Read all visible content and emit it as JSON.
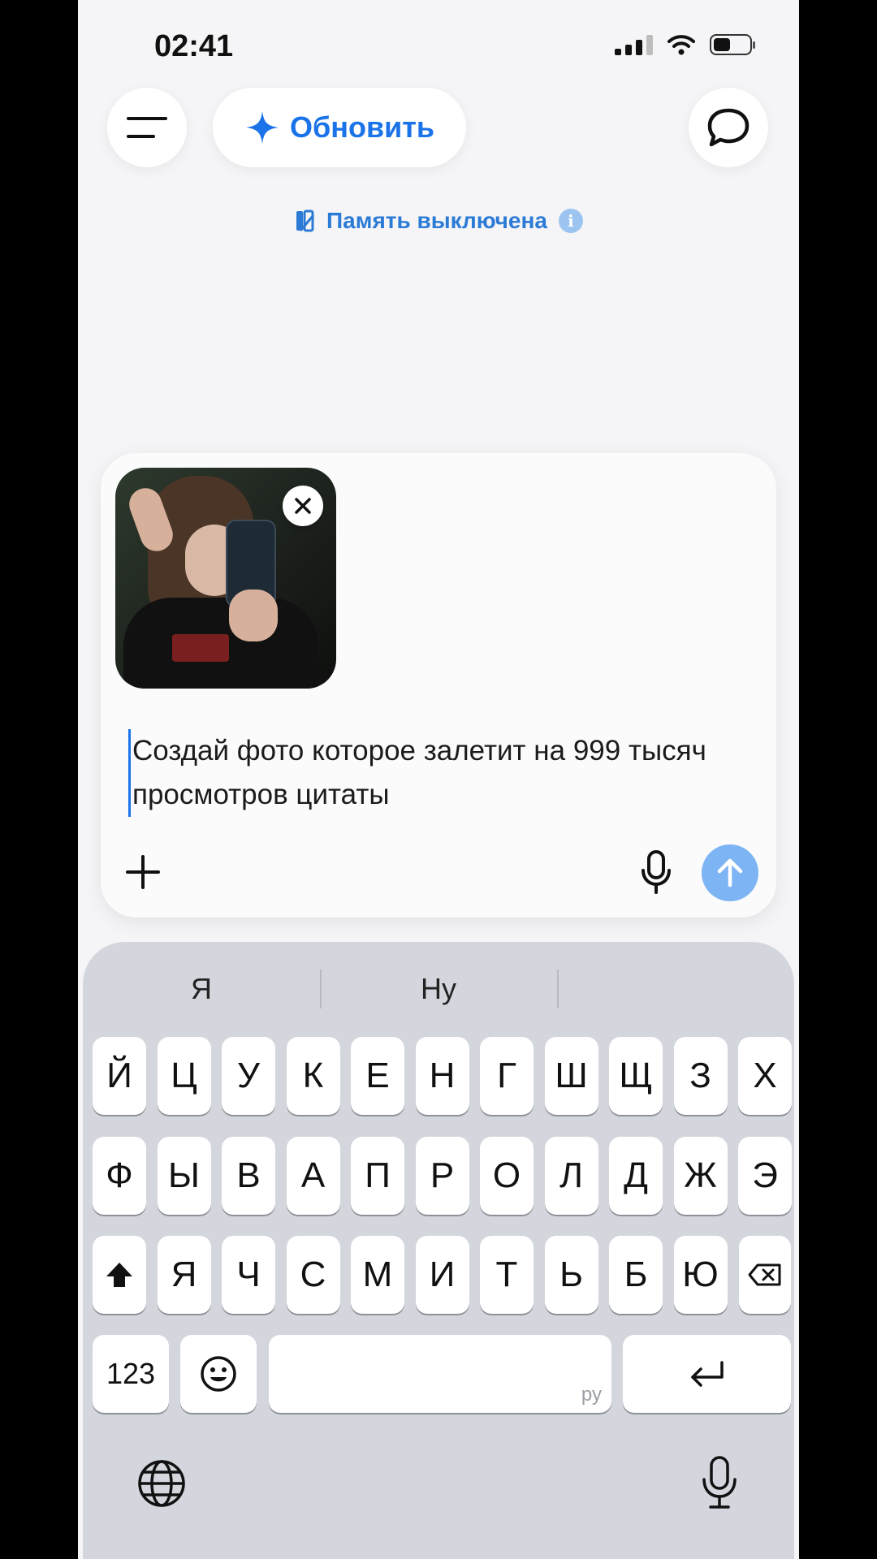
{
  "status_bar": {
    "time": "02:41"
  },
  "header": {
    "upgrade_label": "Обновить",
    "memory_label": "Память выключена"
  },
  "composer": {
    "prompt_text": "Создай фото которое залетит на 999 тысяч просмотров цитаты"
  },
  "keyboard": {
    "suggestions": [
      "Я",
      "Ну",
      ""
    ],
    "row1": [
      "Й",
      "Ц",
      "У",
      "К",
      "Е",
      "Н",
      "Г",
      "Ш",
      "Щ",
      "З",
      "Х"
    ],
    "row2": [
      "Ф",
      "Ы",
      "В",
      "А",
      "П",
      "Р",
      "О",
      "Л",
      "Д",
      "Ж",
      "Э"
    ],
    "row3": [
      "Я",
      "Ч",
      "С",
      "М",
      "И",
      "Т",
      "Ь",
      "Б",
      "Ю"
    ],
    "numbers_label": "123",
    "space_language": "ру"
  },
  "colors": {
    "accent": "#1a73e8",
    "send_disabled": "#7db4f3",
    "keyboard_bg": "#d3d6dc"
  }
}
